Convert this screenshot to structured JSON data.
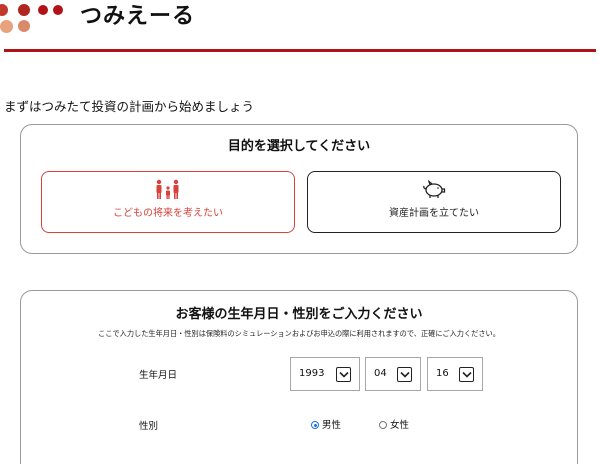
{
  "app": {
    "title": "つみえーる"
  },
  "colors": {
    "accent": "#b01218",
    "selected": "#d9413b",
    "dots": [
      "#c0392b",
      "#b0261f",
      "#e8a27e",
      "#d98a6a",
      "#b01218"
    ]
  },
  "intro_text": "まずはつみたて投資の計画から始めましょう",
  "purpose": {
    "title": "目的を選択してください",
    "options": [
      {
        "label": "こどもの将来を考えたい",
        "icon": "family-icon",
        "selected": true
      },
      {
        "label": "資産計画を立てたい",
        "icon": "piggy-bank-icon",
        "selected": false
      }
    ]
  },
  "profile": {
    "title": "お客様の生年月日・性別をご入力ください",
    "note": "ここで入力した生年月日・性別は保険料のシミュレーションおよびお申込の際に利用されますので、正確にご入力ください。",
    "birthdate_label": "生年月日",
    "birth_year": "1993",
    "birth_month": "04",
    "birth_day": "16",
    "gender_label": "性別",
    "gender_options": [
      {
        "label": "男性",
        "checked": true
      },
      {
        "label": "女性",
        "checked": false
      }
    ]
  }
}
